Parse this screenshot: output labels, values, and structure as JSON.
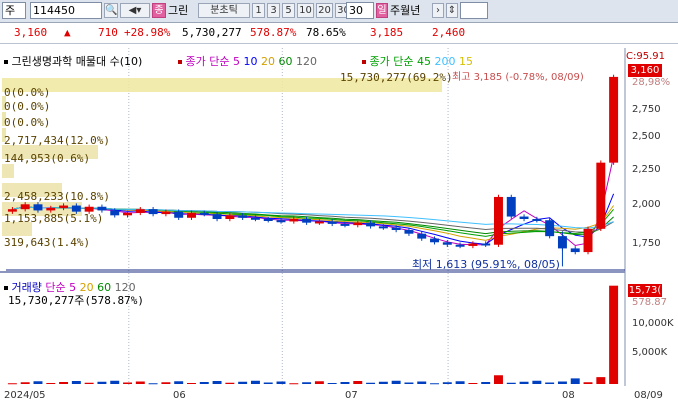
{
  "toolbar": {
    "market": "주",
    "code": "114450",
    "name_tag": "종",
    "name": "그린",
    "interval_label": "분초틱",
    "intervals": [
      "1",
      "3",
      "5",
      "10",
      "20",
      "30"
    ],
    "interval_selected": "30",
    "period_tag": "일",
    "period_rest": "주월년"
  },
  "info": {
    "price": "3,160",
    "arrow": "▲",
    "change": "710",
    "change_pct": "+28.98%",
    "volume": "5,730,277",
    "volume_pct": "578.87%",
    "turnover_pct": "78.65%",
    "high": "3,185",
    "low": "2,460"
  },
  "price_legend": {
    "title": "그린생명과학 매물대 수(10)",
    "ma_title": "종가 단순",
    "ma_periods": [
      "5",
      "10",
      "20",
      "60",
      "120"
    ],
    "ma_colors": [
      "#c000c0",
      "#0000ff",
      "#d4a000",
      "#008800",
      "#666666"
    ],
    "ma2_title": "종가 단순",
    "ma2_periods": [
      "45",
      "200",
      "15"
    ],
    "ma2_colors": [
      "#00a000",
      "#40c0ff",
      "#d4c000"
    ],
    "corner": "C:95.91"
  },
  "profile_labels": [
    "15,730,277(69.2%)",
    "0(0.0%)",
    "0(0.0%)",
    "0(0.0%)",
    "2,717,434(12.0%)",
    "144,953(0.6%)",
    "2,458,233(10.8%)",
    "1,153,885(5.1%)",
    "319,643(1.4%)"
  ],
  "annotations": {
    "high": "최고 3,185 (-0.78%, 08/09)",
    "low": "최저 1,613 (95.91%, 08/05)"
  },
  "price_axis": {
    "current": "3,160",
    "ticks": [
      "2,750",
      "2,500",
      "2,250",
      "2,000",
      "1,750"
    ],
    "top_tick": "28,98%"
  },
  "volume_legend": {
    "title": "거래량",
    "ma_title": "단순",
    "ma_periods": [
      "5",
      "20",
      "60",
      "120"
    ],
    "ma_colors": [
      "#c000c0",
      "#d4a000",
      "#008800",
      "#666666"
    ],
    "value": "15,730,277주(578.87%)"
  },
  "volume_axis": {
    "current": "15,73(",
    "pct": "578.87",
    "ticks": [
      "10,000K",
      "5,000K"
    ]
  },
  "date_axis": [
    "2024/05",
    "06",
    "07",
    "08",
    "08/09"
  ],
  "colors": {
    "up": "#e00000",
    "down": "#0040c0",
    "accent_bg": "#dde4ee"
  },
  "chart_data": {
    "type": "candlestick",
    "ylim": [
      1600,
      3200
    ],
    "x_labels": [
      "2024/05",
      "06",
      "07",
      "08",
      "08/09"
    ],
    "closes": [
      2080,
      2120,
      2070,
      2090,
      2110,
      2060,
      2100,
      2070,
      2030,
      2050,
      2080,
      2040,
      2060,
      2010,
      2050,
      2040,
      2000,
      2030,
      2010,
      2000,
      1990,
      1980,
      2000,
      1970,
      1980,
      1960,
      1950,
      1970,
      1940,
      1930,
      1910,
      1880,
      1840,
      1810,
      1790,
      1780,
      1800,
      1790,
      2180,
      2020,
      2000,
      1990,
      1860,
      1760,
      1730,
      1920,
      2460,
      3160
    ],
    "volume_last": 15730277,
    "volume_ylim": [
      0,
      16000000
    ],
    "low_point": 1613,
    "high_point": 3185
  }
}
